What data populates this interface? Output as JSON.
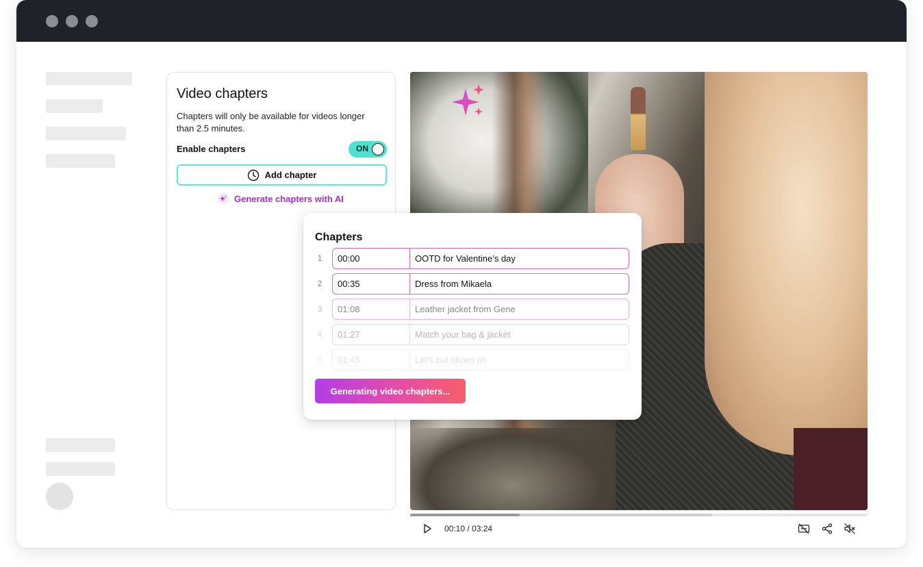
{
  "panel": {
    "title": "Video chapters",
    "description": "Chapters will only be available for videos longer than 2.5 minutes.",
    "enable_label": "Enable chapters",
    "toggle_label": "ON",
    "add_chapter_label": "Add chapter",
    "ai_link_label": "Generate chapters with AI"
  },
  "card": {
    "title": "Chapters",
    "chapters": [
      {
        "num": "1",
        "time": "00:00",
        "name": "OOTD for Valentine’s day"
      },
      {
        "num": "2",
        "time": "00:35",
        "name": "Dress from Mikaela"
      },
      {
        "num": "3",
        "time": "01:08",
        "name": "Leather jacket from Gene"
      },
      {
        "num": "4",
        "time": "01:27",
        "name": "Match your bag & jacket"
      },
      {
        "num": "5",
        "time": "01:45",
        "name": "Let’s put shoes on"
      }
    ],
    "generate_label": "Generating video chapters..."
  },
  "player": {
    "time_label": "00:10 / 03:24",
    "played_fraction": 0.24,
    "buffered_fraction": 0.66
  },
  "colors": {
    "titlebar": "#1f2329",
    "toggle_on": "#4be3d0",
    "add_button_border": "#5ee6d6",
    "ai_accent": "#a431c9",
    "chapter_border": "#d66ad0"
  },
  "icons": {
    "window_controls": [
      "window-dot-icon",
      "window-dot-icon",
      "window-dot-icon"
    ],
    "add_chapter": "clock-icon",
    "ai": "sparkle-icon",
    "video_overlay": "sparkle-icon",
    "play": "play-icon",
    "captions": "captions-off-icon",
    "share": "share-icon",
    "volume": "volume-muted-icon"
  }
}
